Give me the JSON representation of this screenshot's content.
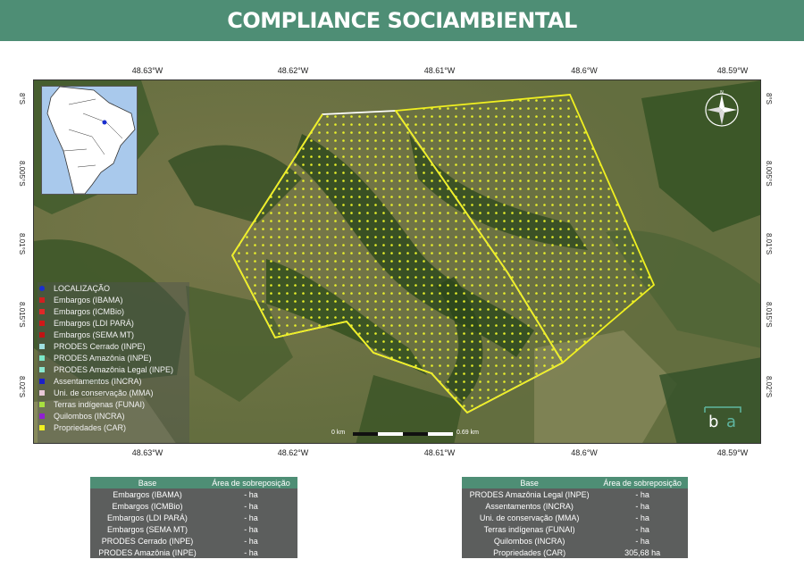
{
  "header": {
    "title": "COMPLIANCE SOCIAMBIENTAL",
    "color": "#4e8e75"
  },
  "axes": {
    "longitudes": [
      "48.63°W",
      "48.62°W",
      "48.61°W",
      "48.6°W",
      "48.59°W"
    ],
    "latitudes": [
      "8°S",
      "8.005°S",
      "8.01°S",
      "8.015°S",
      "8.02°S"
    ]
  },
  "legend": [
    {
      "label": "LOCALIZAÇÃO",
      "color": "#1a2fd0",
      "shape": "circle"
    },
    {
      "label": "Embargos (IBAMA)",
      "color": "#d02020",
      "shape": "square"
    },
    {
      "label": "Embargos (ICMBio)",
      "color": "#e02828",
      "shape": "square"
    },
    {
      "label": "Embargos (LDI PARÁ)",
      "color": "#d01818",
      "shape": "square"
    },
    {
      "label": "Embargos (SEMA MT)",
      "color": "#c01414",
      "shape": "square"
    },
    {
      "label": "PRODES Cerrado (INPE)",
      "color": "#9fe0e0",
      "shape": "square"
    },
    {
      "label": "PRODES Amazônia (INPE)",
      "color": "#7ae8c8",
      "shape": "square"
    },
    {
      "label": "PRODES Amazônia Legal (INPE)",
      "color": "#8ae8d0",
      "shape": "square"
    },
    {
      "label": "Assentamentos (INCRA)",
      "color": "#1c20c8",
      "shape": "square"
    },
    {
      "label": "Uni. de conservação (MMA)",
      "color": "#e8c8d8",
      "shape": "square"
    },
    {
      "label": "Terras indígenas (FUNAI)",
      "color": "#a8e040",
      "shape": "square"
    },
    {
      "label": "Quilombos (INCRA)",
      "color": "#9020d0",
      "shape": "square"
    },
    {
      "label": "Propriedades (CAR)",
      "color": "#f0f020",
      "shape": "square"
    }
  ],
  "scale": {
    "left": "0 km",
    "right": "0.69 km"
  },
  "brand": {
    "text": "b a",
    "color": "#5fb5a0"
  },
  "table_left": {
    "headers": [
      "Base",
      "Área de sobreposição"
    ],
    "rows": [
      [
        "Embargos (IBAMA)",
        "- ha"
      ],
      [
        "Embargos (ICMBio)",
        "- ha"
      ],
      [
        "Embargos (LDI PARÁ)",
        "- ha"
      ],
      [
        "Embargos (SEMA MT)",
        "- ha"
      ],
      [
        "PRODES Cerrado (INPE)",
        "- ha"
      ],
      [
        "PRODES Amazônia (INPE)",
        "- ha"
      ]
    ]
  },
  "table_right": {
    "headers": [
      "Base",
      "Área de sobreposição"
    ],
    "rows": [
      [
        "PRODES Amazônia Legal (INPE)",
        "- ha"
      ],
      [
        "Assentamentos (INCRA)",
        "- ha"
      ],
      [
        "Uni. de conservação (MMA)",
        "- ha"
      ],
      [
        "Terras indígenas (FUNAI)",
        "- ha"
      ],
      [
        "Quilombos (INCRA)",
        "- ha"
      ],
      [
        "Propriedades (CAR)",
        "305,68 ha"
      ]
    ]
  }
}
